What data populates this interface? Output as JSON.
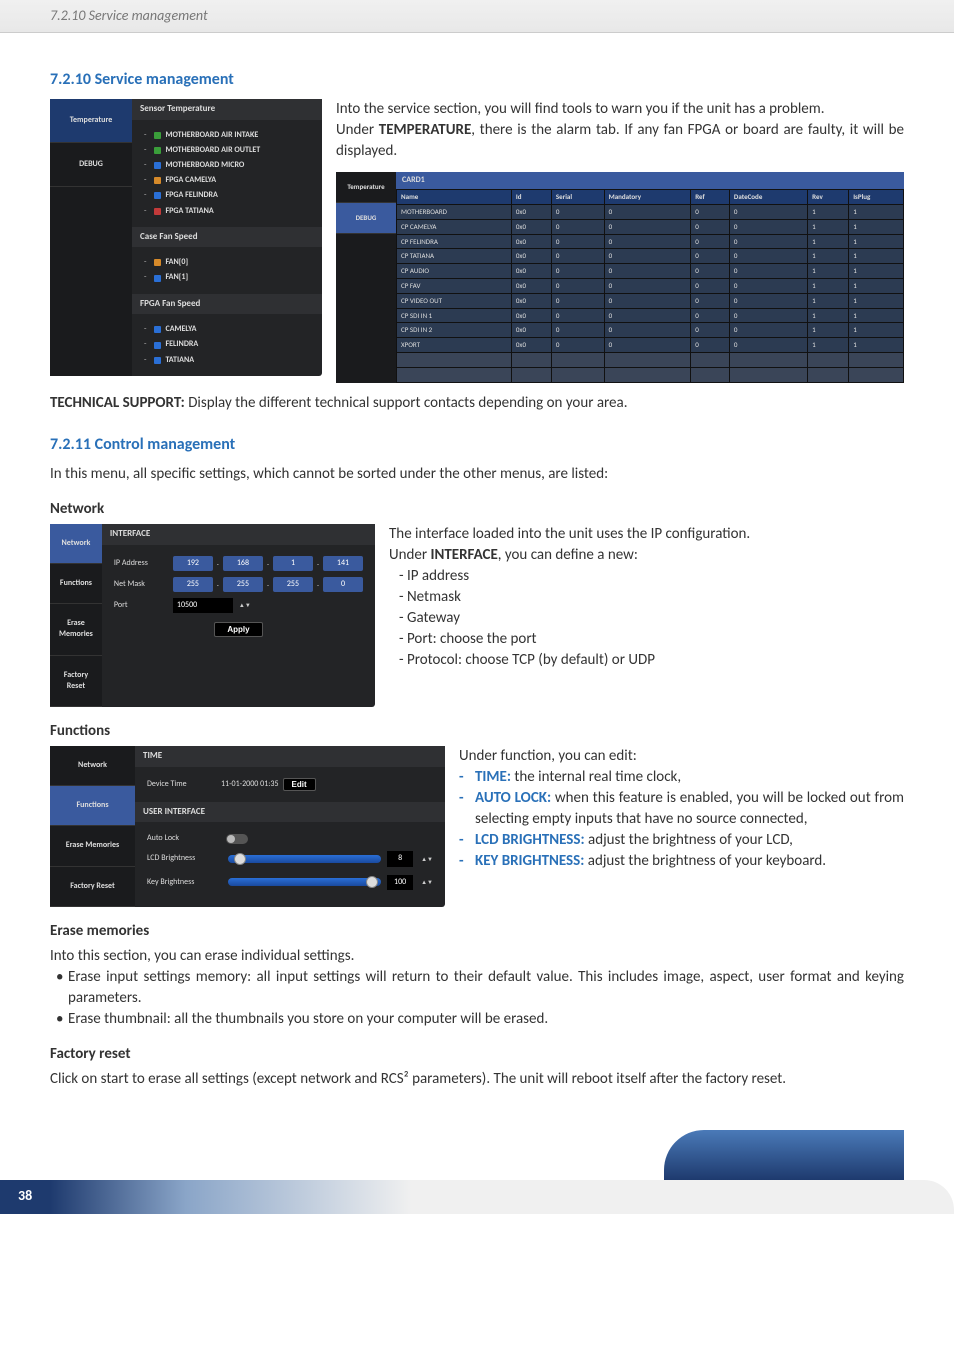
{
  "header": {
    "breadcrumb": "7.2.10 Service management"
  },
  "section_service": {
    "title": "7.2.10 Service management",
    "para1_a": "Into the service section, you will find tools to warn you if the unit has a problem.",
    "para1_b_pre": "Under ",
    "para1_b_bold": "TEMPERATURE",
    "para1_b_post": ", there is the alarm tab. If any fan FPGA or board are faulty, it will be displayed.",
    "tech_support_pre": "TECHNICAL SUPPORT:",
    "tech_support_post": " Display the different technical support contacts depending on your area."
  },
  "temp_panel": {
    "tabs": [
      "Temperature",
      "DEBUG"
    ],
    "sensor_title": "Sensor Temperature",
    "sensors": [
      {
        "label": "MOTHERBOARD AIR INTAKE",
        "color": "#3a9e3a"
      },
      {
        "label": "MOTHERBOARD AIR OUTLET",
        "color": "#3a9e3a"
      },
      {
        "label": "MOTHERBOARD MICRO",
        "color": "#2a6fd6"
      },
      {
        "label": "FPGA CAMELYA",
        "color": "#d68a2a"
      },
      {
        "label": "FPGA FELINDRA",
        "color": "#2a6fd6"
      },
      {
        "label": "FPGA TATIANA",
        "color": "#c23a3a"
      }
    ],
    "case_fan_title": "Case Fan Speed",
    "case_fans": [
      {
        "label": "FAN[0]",
        "color": "#d68a2a"
      },
      {
        "label": "FAN[1]",
        "color": "#2a6fd6"
      }
    ],
    "fpga_fan_title": "FPGA Fan Speed",
    "fpga_fans": [
      {
        "label": "CAMELYA",
        "color": "#2a6fd6"
      },
      {
        "label": "FELINDRA",
        "color": "#2a6fd6"
      },
      {
        "label": "TATIANA",
        "color": "#2a6fd6"
      }
    ]
  },
  "debug_panel": {
    "tabs": [
      "Temperature",
      "DEBUG"
    ],
    "card_title": "CARD1",
    "headers": [
      "Name",
      "Id",
      "Serial",
      "Mandatory",
      "Ref",
      "DateCode",
      "Rev",
      "IsPlug"
    ],
    "rows": [
      [
        "MOTHERBOARD",
        "0x0",
        "0",
        "0",
        "0",
        "0",
        "1",
        "1"
      ],
      [
        "CP CAMELYA",
        "0x0",
        "0",
        "0",
        "0",
        "0",
        "1",
        "1"
      ],
      [
        "CP FELINDRA",
        "0x0",
        "0",
        "0",
        "0",
        "0",
        "1",
        "1"
      ],
      [
        "CP TATIANA",
        "0x0",
        "0",
        "0",
        "0",
        "0",
        "1",
        "1"
      ],
      [
        "CP AUDIO",
        "0x0",
        "0",
        "0",
        "0",
        "0",
        "1",
        "1"
      ],
      [
        "CP FAV",
        "0x0",
        "0",
        "0",
        "0",
        "0",
        "1",
        "1"
      ],
      [
        "CP VIDEO OUT",
        "0x0",
        "0",
        "0",
        "0",
        "0",
        "1",
        "1"
      ],
      [
        "CP SDI IN 1",
        "0x0",
        "0",
        "0",
        "0",
        "0",
        "1",
        "1"
      ],
      [
        "CP SDI IN 2",
        "0x0",
        "0",
        "0",
        "0",
        "0",
        "1",
        "1"
      ],
      [
        "XPORT",
        "0x0",
        "0",
        "0",
        "0",
        "0",
        "1",
        "1"
      ]
    ]
  },
  "section_control": {
    "title": "7.2.11 Control management",
    "intro": "In this menu, all specific settings, which cannot be sorted under the other menus, are listed:"
  },
  "network": {
    "heading": "Network",
    "tabs": [
      "Network",
      "Functions",
      "Erase Memories",
      "Factory Reset"
    ],
    "interface_title": "INTERFACE",
    "ip_label": "IP Address",
    "ip": [
      "192",
      "168",
      "1",
      "141"
    ],
    "mask_label": "Net Mask",
    "mask": [
      "255",
      "255",
      "255",
      "0"
    ],
    "port_label": "Port",
    "port": "10500",
    "apply": "Apply",
    "text_intro": "The interface loaded into the unit uses the IP configuration.",
    "text_under_pre": "Under ",
    "text_under_bold": "INTERFACE",
    "text_under_post": ", you can define a new:",
    "items": [
      "- IP address",
      "- Netmask",
      "- Gateway",
      "- Port: choose the port",
      "- Protocol: choose TCP (by default) or UDP"
    ]
  },
  "functions": {
    "heading": "Functions",
    "tabs": [
      "Network",
      "Functions",
      "Erase Memories",
      "Factory Reset"
    ],
    "time_title": "TIME",
    "device_time_label": "Device Time",
    "device_time_value": "11-01-2000 01:35",
    "edit": "Edit",
    "ui_title": "USER INTERFACE",
    "autolock_label": "Auto Lock",
    "lcd_label": "LCD Brightness",
    "lcd_val": "8",
    "key_label": "Key Brightness",
    "key_val": "100",
    "text_intro": "Under function, you can edit:",
    "lines": [
      {
        "key": "TIME:",
        "rest": " the internal real time clock,"
      },
      {
        "key": "AUTO LOCK:",
        "rest": " when this feature is enabled, you will be locked out from selecting empty inputs that have no source connected,"
      },
      {
        "key": "LCD BRIGHTNESS:",
        "rest": " adjust the brightness of your LCD,"
      },
      {
        "key": "KEY BRIGHTNESS:",
        "rest": " adjust the brightness of your keyboard."
      }
    ]
  },
  "erase": {
    "heading": "Erase memories",
    "intro": "Into this section, you can erase individual settings.",
    "bullets": [
      "Erase input settings memory: all input settings will return to their default value. This includes image, aspect, user format and keying parameters.",
      "Erase thumbnail: all the thumbnails you store on your computer will be erased."
    ]
  },
  "factory": {
    "heading": "Factory reset",
    "text": "Click on start to erase all settings (except network and RCS² parameters). The unit will reboot itself after the factory reset."
  },
  "footer": {
    "page": "38"
  }
}
